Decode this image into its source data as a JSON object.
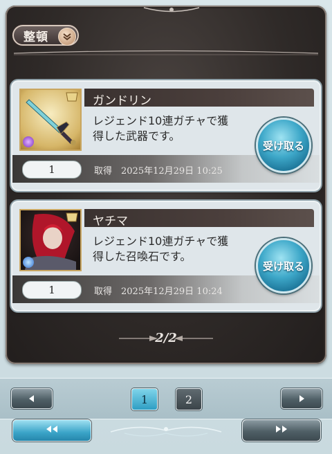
{
  "header": {
    "sort_label": "整頓"
  },
  "items": [
    {
      "name": "ガンドリン",
      "description": "レジェンド10連ガチャで獲\n得した武器です。",
      "quantity": "1",
      "obtained_label": "取得　2025年12月29日 10:25",
      "receive_label": "受け取る",
      "thumb": "weapon-sword",
      "rarity_badge": "SSR"
    },
    {
      "name": "ヤチマ",
      "description": "レジェンド10連ガチャで獲\n得した召喚石です。",
      "quantity": "1",
      "obtained_label": "取得　2025年12月29日 10:24",
      "receive_label": "受け取る",
      "thumb": "summon-character",
      "rarity_badge": "SSR"
    }
  ],
  "pager": {
    "text": "2/2",
    "pages": [
      "1",
      "2"
    ],
    "active_page": "1",
    "prev_icon": "triangle-left-icon",
    "next_icon": "triangle-right-icon",
    "first_icon": "double-triangle-left-icon",
    "last_icon": "double-triangle-right-icon"
  },
  "colors": {
    "frame": "#2f2a28",
    "accent_blue": "#3ea8c9",
    "card_bg": "#dfe6ea",
    "name_bar": "#3a3230"
  }
}
